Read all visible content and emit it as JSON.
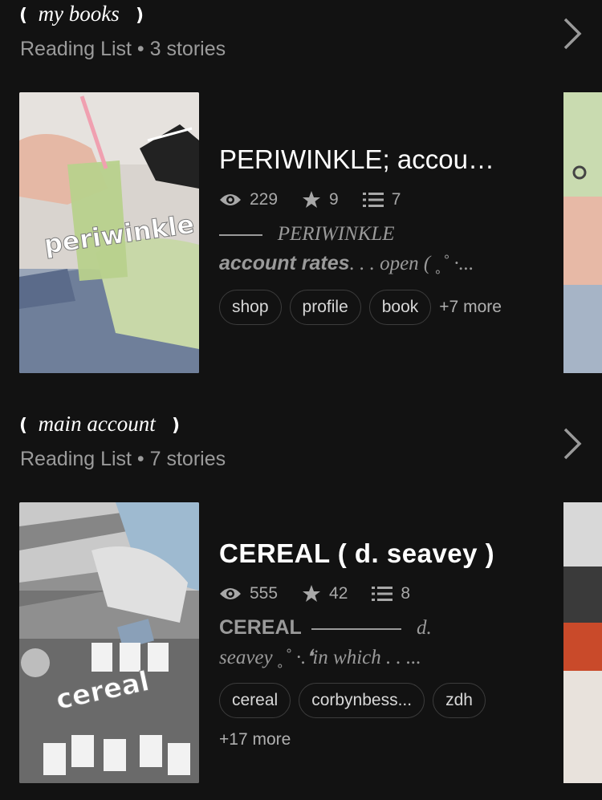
{
  "lists": [
    {
      "title": "my books",
      "subtitle": "Reading List • 3 stories",
      "story": {
        "title": "PERIWINKLE; accou…",
        "reads": "229",
        "votes": "9",
        "parts": "7",
        "desc_line1": "PERIWINKLE",
        "desc_line2_bold": "account rates",
        "desc_line2_rest": ". . . open ( ˳˚ ·...",
        "tags": [
          "shop",
          "profile",
          "book"
        ],
        "more": "+7 more",
        "cover_text": "periwinkle"
      }
    },
    {
      "title": "main account",
      "subtitle": "Reading List • 7 stories",
      "story": {
        "title": "CEREAL ( d. seavey )",
        "reads": "555",
        "votes": "42",
        "parts": "8",
        "desc_line1_sans": "CEREAL",
        "desc_line1_end": "d.",
        "desc_line2": "seavey ˳˚ ·.❛in which .  .  ...",
        "tags": [
          "cereal",
          "corbynbess...",
          "zdh"
        ],
        "more": "+17 more",
        "cover_text": "cereal"
      }
    }
  ],
  "icons": [
    "eye-icon",
    "star-icon",
    "list-icon",
    "chevron-right-icon"
  ]
}
